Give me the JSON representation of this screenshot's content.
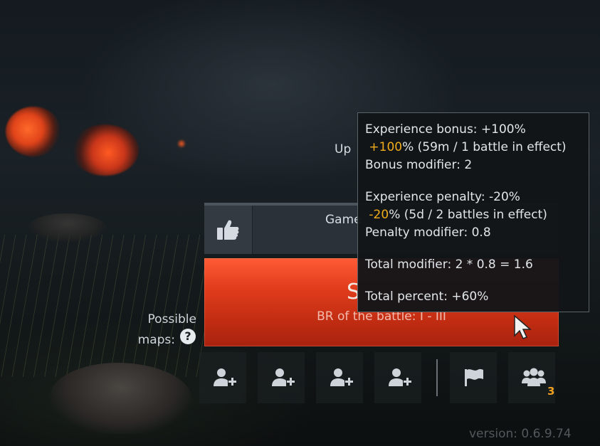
{
  "header": {
    "up_label": "Up"
  },
  "game_mode": {
    "name": "Game"
  },
  "start_button": {
    "label": "S",
    "br_text": "BR of the battle: I - III"
  },
  "maps": {
    "label_line1": "Possible",
    "label_line2": "maps:",
    "help_icon_text": "?"
  },
  "squad": {
    "count": "3",
    "icons": [
      "add-player-icon",
      "add-player-icon",
      "add-player-icon",
      "add-player-icon",
      "flag-icon",
      "squad-icon"
    ]
  },
  "tooltip": {
    "exp_bonus": "Experience bonus: +100%",
    "exp_bonus_value": "+100",
    "exp_bonus_detail": "% (59m / 1 battle in effect)",
    "bonus_modifier": "Bonus modifier: 2",
    "exp_penalty": "Experience penalty: -20%",
    "exp_penalty_value": "-20",
    "exp_penalty_detail": "% (5d / 2 battles in effect)",
    "penalty_modifier": "Penalty modifier: 0.8",
    "total_modifier": "Total modifier: 2 * 0.8 = 1.6",
    "total_percent": "Total percent: +60%"
  },
  "footer": {
    "version": "version: 0.6.9.74"
  },
  "colors": {
    "accent_gold": "#f0ac1a",
    "start_red": "#e03c1c"
  }
}
